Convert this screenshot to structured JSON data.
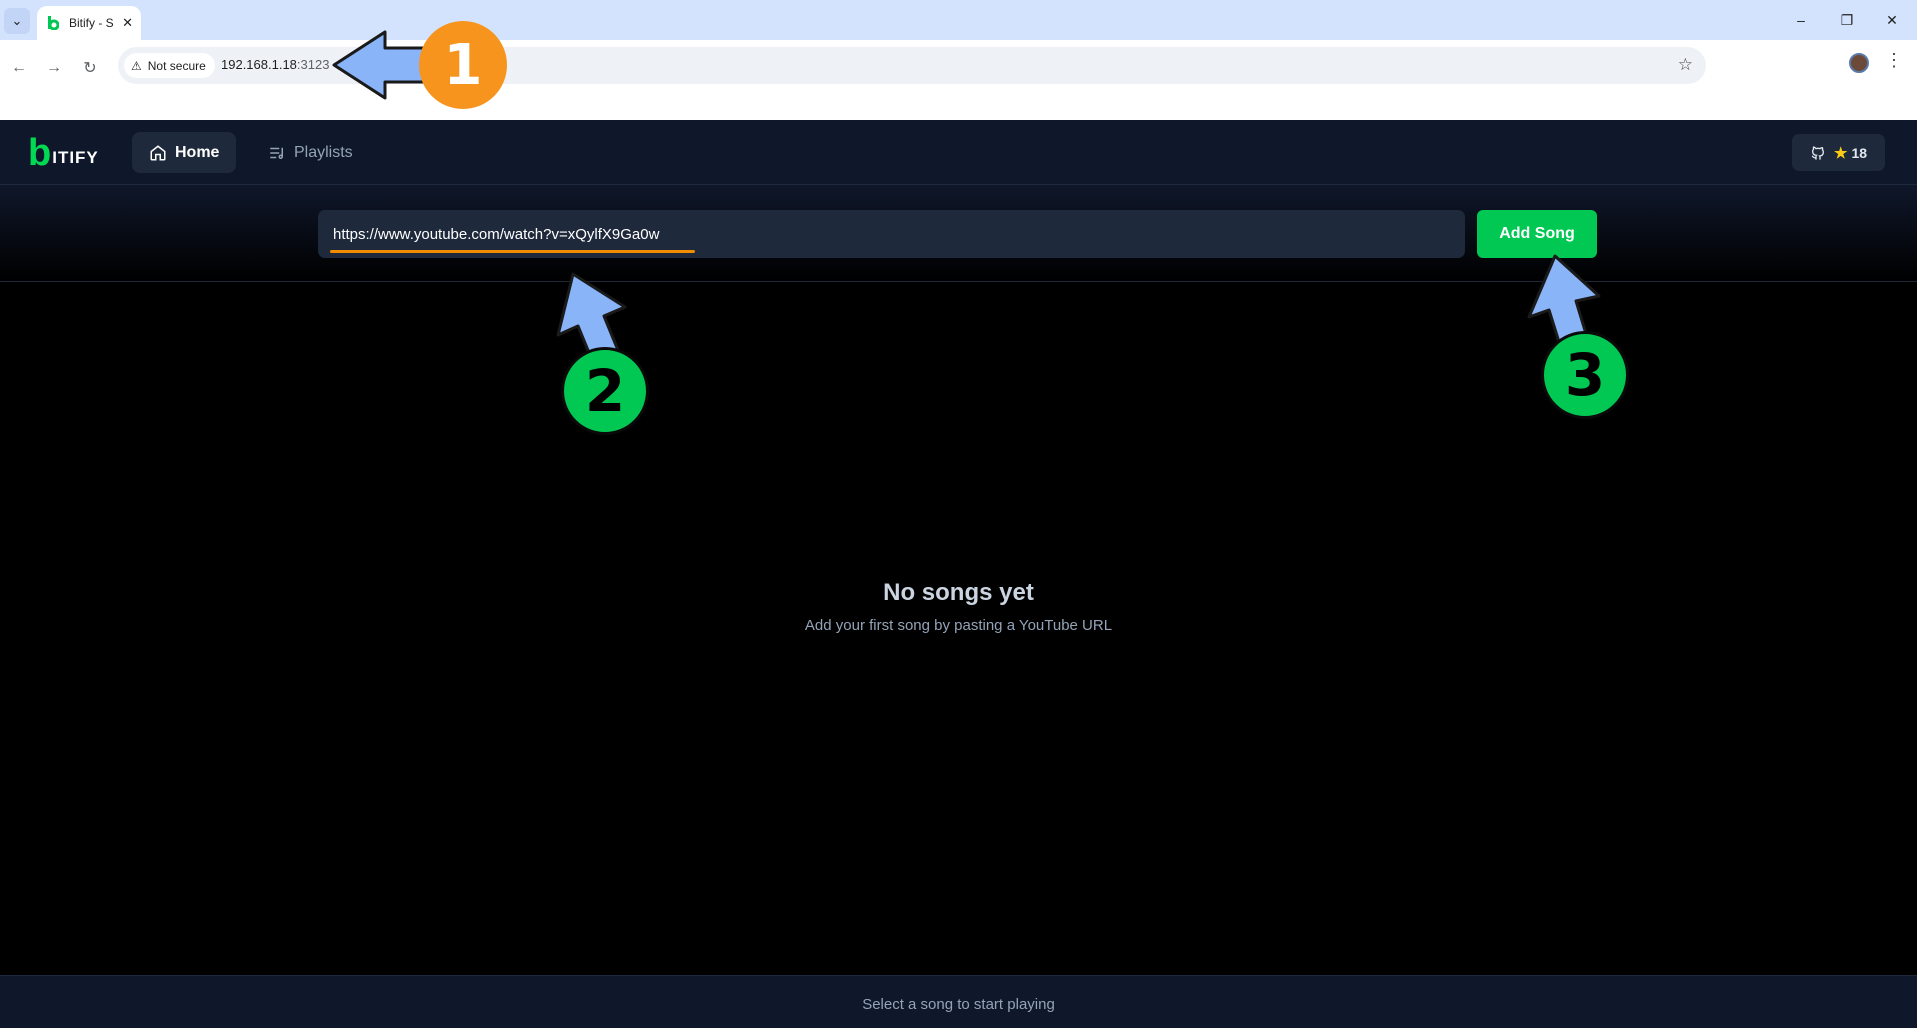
{
  "browser": {
    "tab_title": "Bitify - S",
    "security_label": "Not secure",
    "url_host": "192.168.1.18",
    "url_port": ":3123"
  },
  "app": {
    "logo_letter": "b",
    "logo_text": "ITIFY",
    "nav": {
      "home_label": "Home",
      "playlists_label": "Playlists"
    },
    "github_stars": "18",
    "input_value": "https://www.youtube.com/watch?v=xQylfX9Ga0w",
    "add_button_label": "Add Song",
    "empty_title": "No songs yet",
    "empty_subtitle": "Add your first song by pasting a YouTube URL",
    "player_status": "Select a song to start playing"
  },
  "annotations": {
    "step1": "1",
    "step2": "2",
    "step3": "3"
  },
  "colors": {
    "accent_green": "#00c853",
    "annotation_orange": "#f7941d",
    "annotation_arrow": "#8ab4f8",
    "app_nav_bg": "#0f172a"
  }
}
